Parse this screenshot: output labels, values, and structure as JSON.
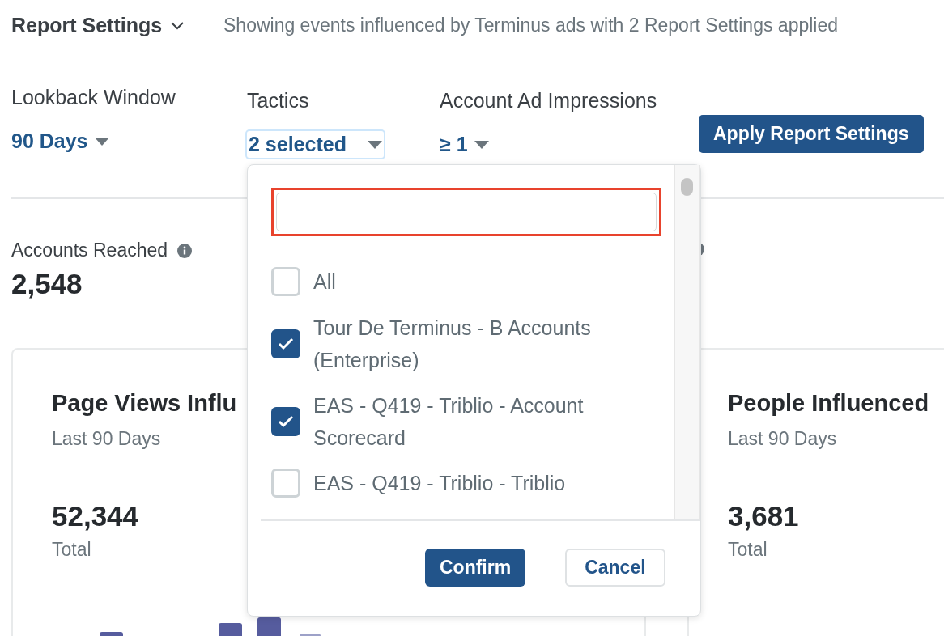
{
  "header": {
    "title": "Report Settings",
    "summary": "Showing events influenced by Terminus ads with 2 Report Settings applied"
  },
  "settings": [
    {
      "label": "Lookback Window",
      "value": "90 Days",
      "focused": false
    },
    {
      "label": "Tactics",
      "value": "2 selected",
      "focused": true
    },
    {
      "label": "Account Ad Impressions",
      "value": "≥ 1",
      "focused": false
    }
  ],
  "apply_button": "Apply Report Settings",
  "metrics": [
    {
      "label": "Accounts Reached",
      "value": "2,548"
    }
  ],
  "cards": [
    {
      "title": "Page Views Influ",
      "subtitle": "Last 90 Days",
      "value": "52,344",
      "caption": "Total"
    },
    {
      "title": "People Influenced",
      "subtitle": "Last 90 Days",
      "value": "3,681",
      "caption": "Total"
    }
  ],
  "tactics_dropdown": {
    "search": {
      "highlighted": true
    },
    "options": [
      {
        "label": "All",
        "checked": false
      },
      {
        "label": "Tour De Terminus - B Accounts (Enterprise)",
        "checked": true
      },
      {
        "label": "EAS - Q419 - Triblio - Account Scorecard",
        "checked": true
      },
      {
        "label": "EAS - Q419 - Triblio - Triblio",
        "checked": false
      }
    ],
    "confirm_button": "Confirm",
    "cancel_button": "Cancel"
  }
}
